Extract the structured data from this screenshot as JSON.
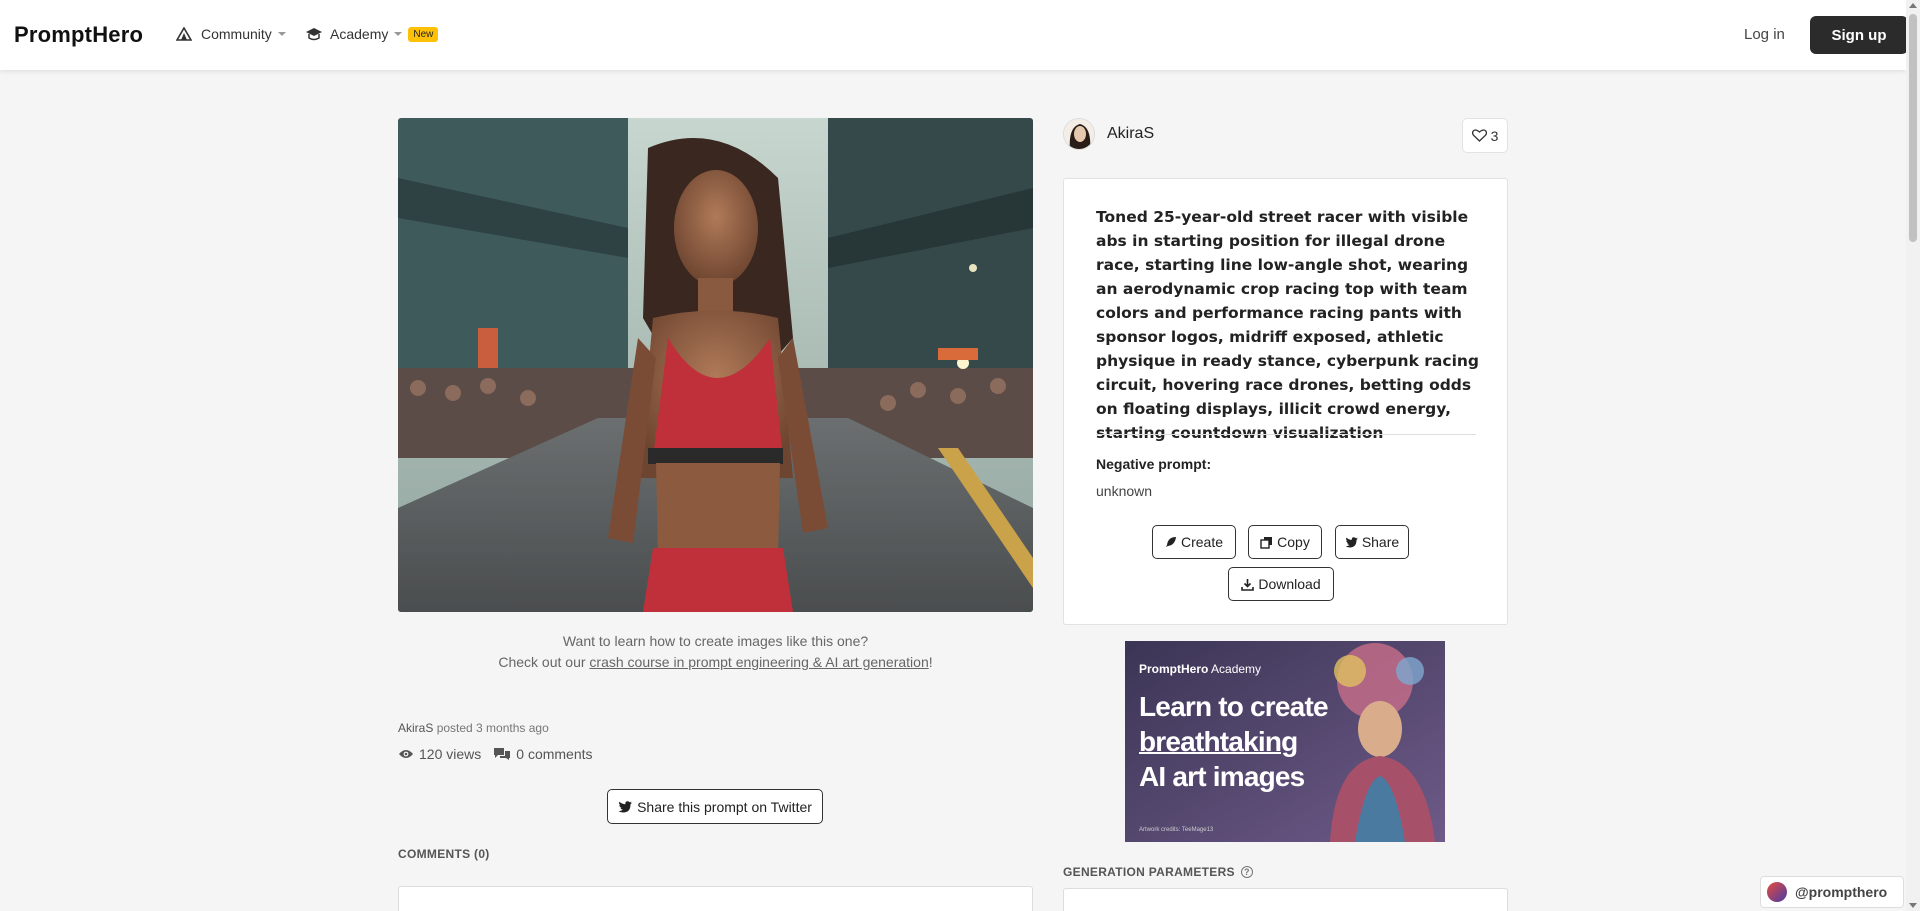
{
  "navbar": {
    "brand": "PromptHero",
    "community_label": "Community",
    "academy_label": "Academy",
    "new_badge": "New",
    "login_label": "Log in",
    "signup_label": "Sign up"
  },
  "image": {
    "learn_line1": "Want to learn how to create images like this one?",
    "learn_prefix": "Check out our ",
    "learn_link": "crash course in prompt engineering & AI art generation",
    "learn_suffix": "!"
  },
  "post": {
    "author": "AkiraS",
    "posted_text": "posted 3 months ago",
    "views": "120 views",
    "comments": "0 comments",
    "share_twitter_label": "Share this prompt on Twitter",
    "comments_title": "COMMENTS (0)"
  },
  "prompt": {
    "author": "AkiraS",
    "likes": "3",
    "text": "Toned 25-year-old street racer with visible abs in starting position for illegal drone race, starting line low-angle shot, wearing an aerodynamic crop racing top with team colors and performance racing pants with sponsor logos, midriff exposed, athletic physique in ready stance, cyberpunk racing circuit, hovering race drones, betting odds on floating displays, illicit crowd energy, starting countdown visualization",
    "negative_label": "Negative prompt:",
    "negative_value": "unknown",
    "create_label": "Create",
    "copy_label": "Copy",
    "share_label": "Share",
    "download_label": "Download"
  },
  "ad": {
    "brand_bold": "PromptHero",
    "brand_rest": " Academy",
    "line1": "Learn to create",
    "line2": "breathtaking",
    "line3": "AI art images",
    "credits": "Artwork credits: TeeMage13"
  },
  "generation": {
    "title": "GENERATION PARAMETERS",
    "help": "?"
  },
  "handle": "@prompthero",
  "colors": {
    "accent_dark": "#2b2b2b",
    "badge": "#ffc107"
  }
}
